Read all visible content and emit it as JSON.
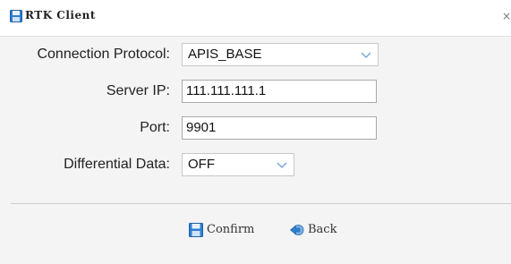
{
  "window": {
    "title": "RTK Client",
    "close_glyph": "×"
  },
  "form": {
    "protocol": {
      "label": "Connection Protocol:",
      "value": "APIS_BASE"
    },
    "server_ip": {
      "label": "Server IP:",
      "value": "111.111.111.1"
    },
    "port": {
      "label": "Port:",
      "value": "9901"
    },
    "differential": {
      "label": "Differential Data:",
      "value": "OFF"
    }
  },
  "buttons": {
    "confirm": "Confirm",
    "back": "Back"
  },
  "icons": {
    "title": "floppy-disk-icon",
    "confirm": "floppy-disk-icon",
    "back": "back-arrow-icon",
    "dropdown": "chevron-down-icon"
  },
  "colors": {
    "accent": "#2f7fd0",
    "chevron": "#7aa7d8"
  }
}
